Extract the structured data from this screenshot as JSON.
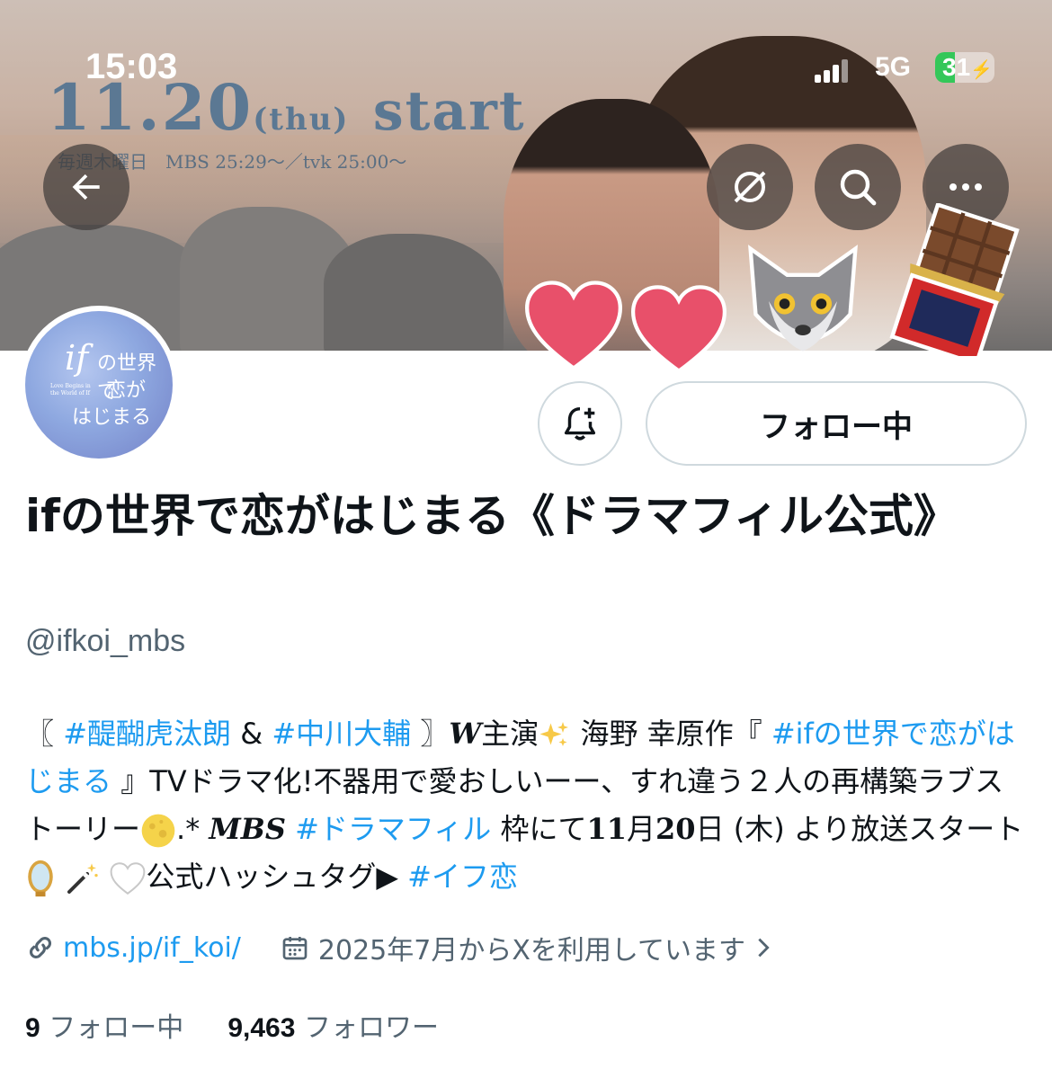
{
  "status_bar": {
    "time": "15:03",
    "network": "5G",
    "battery": "31"
  },
  "banner": {
    "date": "11.20",
    "weekday": "(thu)",
    "start": "start",
    "schedule": "毎週木曜日　MBS 25:29～／tvk 25:00～"
  },
  "avatar_text": {
    "if": "if",
    "line1": "の世界で",
    "line2": "恋が",
    "line3": "はじまる",
    "small": "Love Begins in the World of If"
  },
  "buttons": {
    "follow_label": "フォロー中"
  },
  "profile": {
    "name": "ifの世界で恋がはじまる《ドラマフィル公式》",
    "handle": "@ifkoi_mbs"
  },
  "bio": {
    "p1": "〖 ",
    "tag1": "#醍醐虎汰朗",
    "p2": " & ",
    "tag2": "#中川大輔",
    "p3": " 〗",
    "w": "W",
    "p4": "主演",
    "p5": "海野 幸原作『 ",
    "tag3": "#ifの世界で恋がはじまる",
    "p6": " 』TVドラマ化!不器用で愛おしいーー、すれ違う２人の再構築ラブストーリー",
    "p7": ".* ",
    "mbs": "MBS",
    "p8": " ",
    "tag4": "#ドラマフィル",
    "p9": " 枠にて",
    "num1": "11",
    "p10": "月",
    "num2": "20",
    "p11": "日 (木) より放送スタート",
    "p12": "公式ハッシュタグ▶ ",
    "tag5": "#イフ恋"
  },
  "meta": {
    "link": "mbs.jp/if_koi/",
    "joined": "2025年7月からXを利用しています"
  },
  "counts": {
    "following_num": "9",
    "following_label": "フォロー中",
    "followers_num": "9,463",
    "followers_label": "フォロワー"
  },
  "colors": {
    "link": "#1d9bf0",
    "text": "#0f1419",
    "muted": "#536471",
    "promo": "#5b7893"
  },
  "icons": [
    "back-arrow-icon",
    "grok-icon",
    "search-icon",
    "more-icon",
    "bell-plus-icon",
    "link-icon",
    "calendar-icon",
    "chevron-right-icon"
  ]
}
